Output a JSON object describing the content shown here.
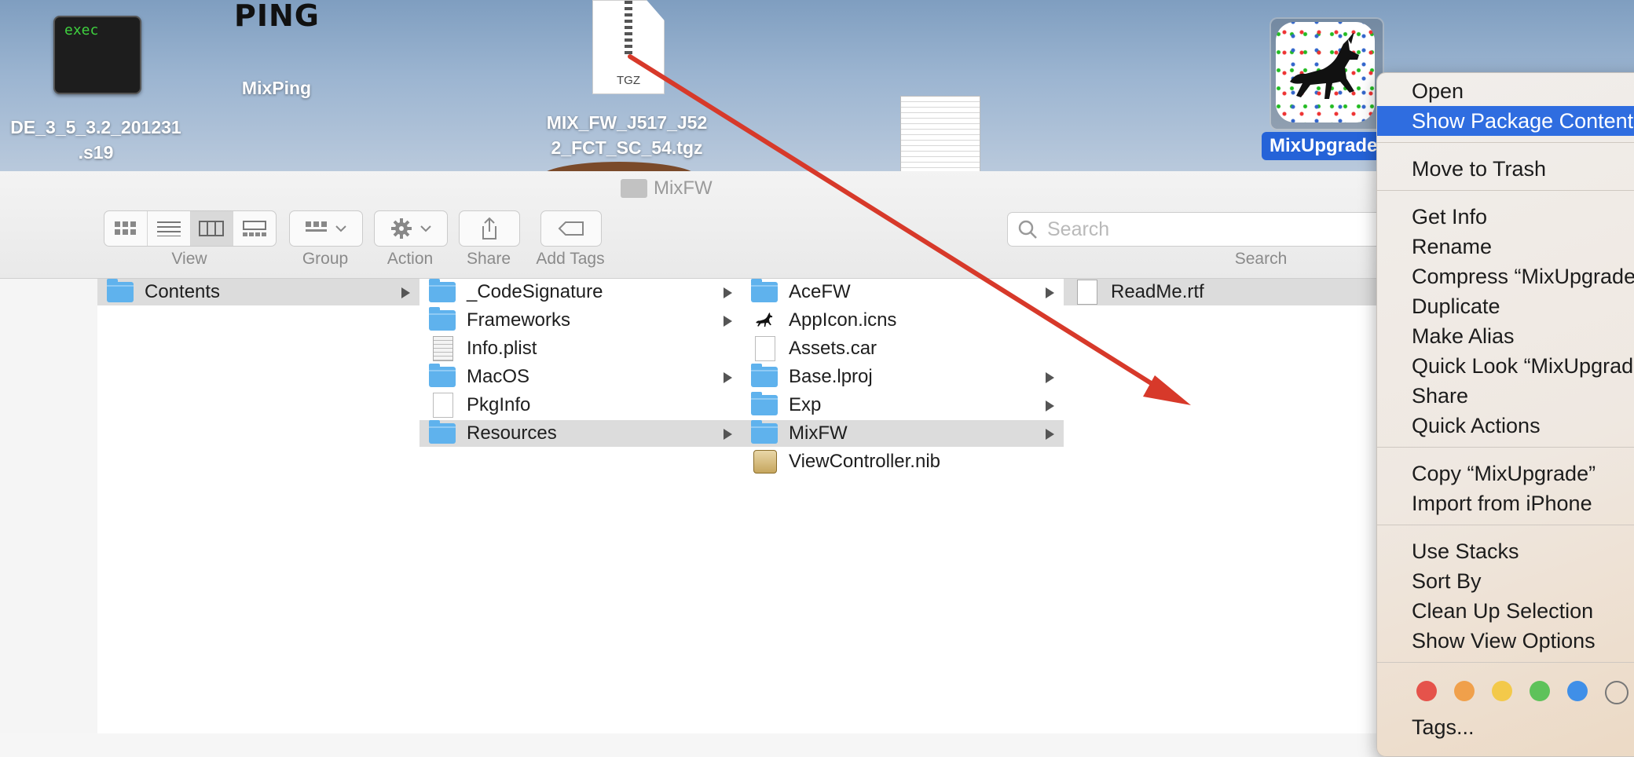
{
  "desktop": {
    "icons": [
      {
        "name": "exec-file",
        "icon_text": "exec",
        "label_line1": "DE_3_5_3.2_201231",
        "label_line2": ".s19"
      },
      {
        "name": "mixping",
        "icon_text": "PING",
        "label": "MixPing"
      },
      {
        "name": "tgz-archive",
        "icon_text": "TGZ",
        "label_line1": "MIX_FW_J517_J52",
        "label_line2": "2_FCT_SC_54.tgz"
      },
      {
        "name": "mixupgrade-app",
        "label": "MixUpgrade"
      }
    ]
  },
  "finder": {
    "window_title": "MixFW",
    "toolbar": {
      "view_label": "View",
      "group_label": "Group",
      "action_label": "Action",
      "share_label": "Share",
      "tags_label": "Add Tags",
      "search_label": "Search",
      "search_placeholder": "Search"
    },
    "columns": [
      {
        "items": [
          {
            "label": "Contents",
            "kind": "folder",
            "has_children": true,
            "selected": true
          }
        ]
      },
      {
        "items": [
          {
            "label": "_CodeSignature",
            "kind": "folder",
            "has_children": true,
            "selected": false
          },
          {
            "label": "Frameworks",
            "kind": "folder",
            "has_children": true,
            "selected": false
          },
          {
            "label": "Info.plist",
            "kind": "plist",
            "has_children": false,
            "selected": false
          },
          {
            "label": "MacOS",
            "kind": "folder",
            "has_children": true,
            "selected": false
          },
          {
            "label": "PkgInfo",
            "kind": "file",
            "has_children": false,
            "selected": false
          },
          {
            "label": "Resources",
            "kind": "folder",
            "has_children": true,
            "selected": true
          }
        ]
      },
      {
        "items": [
          {
            "label": "AceFW",
            "kind": "folder",
            "has_children": true,
            "selected": false
          },
          {
            "label": "AppIcon.icns",
            "kind": "horse",
            "has_children": false,
            "selected": false
          },
          {
            "label": "Assets.car",
            "kind": "file",
            "has_children": false,
            "selected": false
          },
          {
            "label": "Base.lproj",
            "kind": "folder",
            "has_children": true,
            "selected": false
          },
          {
            "label": "Exp",
            "kind": "folder",
            "has_children": true,
            "selected": false
          },
          {
            "label": "MixFW",
            "kind": "folder",
            "has_children": true,
            "selected": true
          },
          {
            "label": "ViewController.nib",
            "kind": "nib",
            "has_children": false,
            "selected": false
          }
        ]
      },
      {
        "items": [
          {
            "label": "ReadMe.rtf",
            "kind": "rtf",
            "has_children": false,
            "selected": true
          }
        ]
      }
    ]
  },
  "context_menu": {
    "groups": [
      [
        "Open",
        "Show Package Contents"
      ],
      [
        "Move to Trash"
      ],
      [
        "Get Info",
        "Rename",
        "Compress “MixUpgrade”",
        "Duplicate",
        "Make Alias",
        "Quick Look “MixUpgrade”",
        "Share",
        "Quick Actions"
      ],
      [
        "Copy “MixUpgrade”",
        "Import from iPhone"
      ],
      [
        "Use Stacks",
        "Sort By",
        "Clean Up Selection",
        "Show View Options"
      ]
    ],
    "highlighted": "Show Package Contents",
    "tags_label": "Tags...",
    "tag_colors": [
      "#e5534b",
      "#f0a04b",
      "#f3c94a",
      "#5ec25a",
      "#3f8fe8",
      "transparent"
    ]
  },
  "colors": {
    "selection_blue": "#2f6de0",
    "annotation_arrow": "#d7392a",
    "folder_blue": "#5fb2ed"
  }
}
